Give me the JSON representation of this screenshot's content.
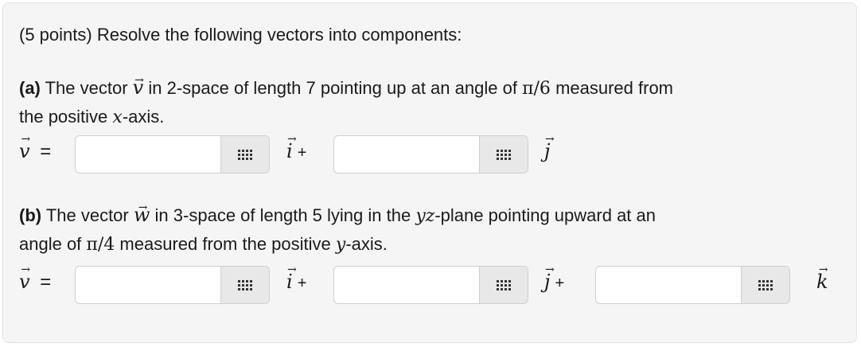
{
  "intro": "(5 points) Resolve the following vectors into components:",
  "part_a": {
    "label": "(a)",
    "text_1": "The vector",
    "vector": "v",
    "text_2": "in 2-space of length 7 pointing up at an angle of",
    "angle": "π/6",
    "text_3": "measured from",
    "line2_pre": "the positive",
    "axis": "x",
    "line2_post": "-axis.",
    "answer_fields": [
      {
        "value": "",
        "unit": "i",
        "suffix": "+"
      },
      {
        "value": "",
        "unit": "j",
        "suffix": ""
      }
    ]
  },
  "part_b": {
    "label": "(b)",
    "text_1": "The vector",
    "vector": "w",
    "text_2": "in 3-space of length 5 lying in the",
    "plane": "yz",
    "text_3": "-plane pointing upward at an",
    "line2_pre": "angle of",
    "angle": "π/4",
    "line2_mid": "measured from the positive",
    "axis": "y",
    "line2_post": "-axis.",
    "lhs_vector": "v",
    "answer_fields": [
      {
        "value": "",
        "unit": "i",
        "suffix": "+"
      },
      {
        "value": "",
        "unit": "j",
        "suffix": "+"
      },
      {
        "value": "",
        "unit": "k",
        "suffix": ""
      }
    ]
  },
  "equals": "=",
  "arrow": "→",
  "icons": {
    "keypad": "keypad-grid-icon"
  }
}
